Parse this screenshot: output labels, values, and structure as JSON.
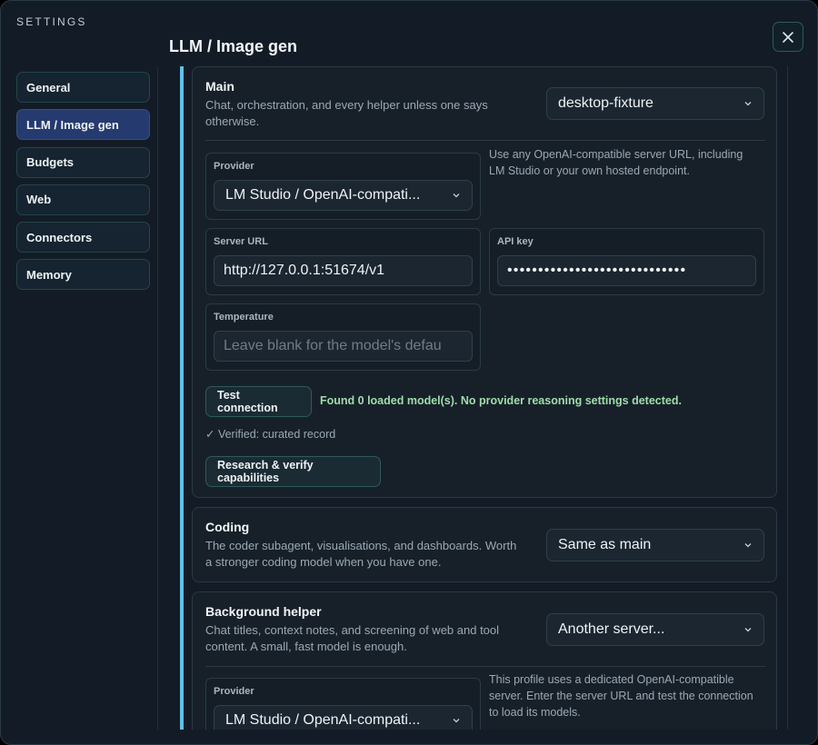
{
  "header": {
    "section_label": "SETTINGS",
    "page_title": "LLM / Image gen",
    "close_icon": "close-icon"
  },
  "sidebar": {
    "items": [
      {
        "label": "General",
        "active": false
      },
      {
        "label": "LLM / Image gen",
        "active": true
      },
      {
        "label": "Budgets",
        "active": false
      },
      {
        "label": "Web",
        "active": false
      },
      {
        "label": "Connectors",
        "active": false
      },
      {
        "label": "Memory",
        "active": false
      }
    ]
  },
  "main": {
    "title": "Main",
    "description": "Chat, orchestration, and every helper unless one says otherwise.",
    "model_select": "desktop-fixture",
    "provider_label": "Provider",
    "provider_value": "LM Studio / OpenAI-compati...",
    "provider_hint": "Use any OpenAI-compatible server URL, including LM Studio or your own hosted endpoint.",
    "server_url_label": "Server URL",
    "server_url_value": "http://127.0.0.1:51674/v1",
    "api_key_label": "API key",
    "api_key_value": "•••••••••••••••••••••••••••••",
    "temperature_label": "Temperature",
    "temperature_placeholder": "Leave blank for the model's defau",
    "test_button": "Test connection",
    "test_status": "Found 0 loaded model(s). No provider reasoning settings detected.",
    "verified_text": "✓ Verified: curated record",
    "research_button": "Research & verify capabilities"
  },
  "coding": {
    "title": "Coding",
    "description": "The coder subagent, visualisations, and dashboards. Worth a stronger coding model when you have one.",
    "model_select": "Same as main"
  },
  "background_helper": {
    "title": "Background helper",
    "description": "Chat titles, context notes, and screening of web and tool content. A small, fast model is enough.",
    "model_select": "Another server...",
    "provider_label": "Provider",
    "provider_value": "LM Studio / OpenAI-compati...",
    "provider_hint": "This profile uses a dedicated OpenAI-compatible server. Enter the server URL and test the connection to load its models."
  },
  "colors": {
    "accent": "#5fc0e8",
    "active_nav": "#253a6e",
    "success_text": "#9fdcaa"
  }
}
